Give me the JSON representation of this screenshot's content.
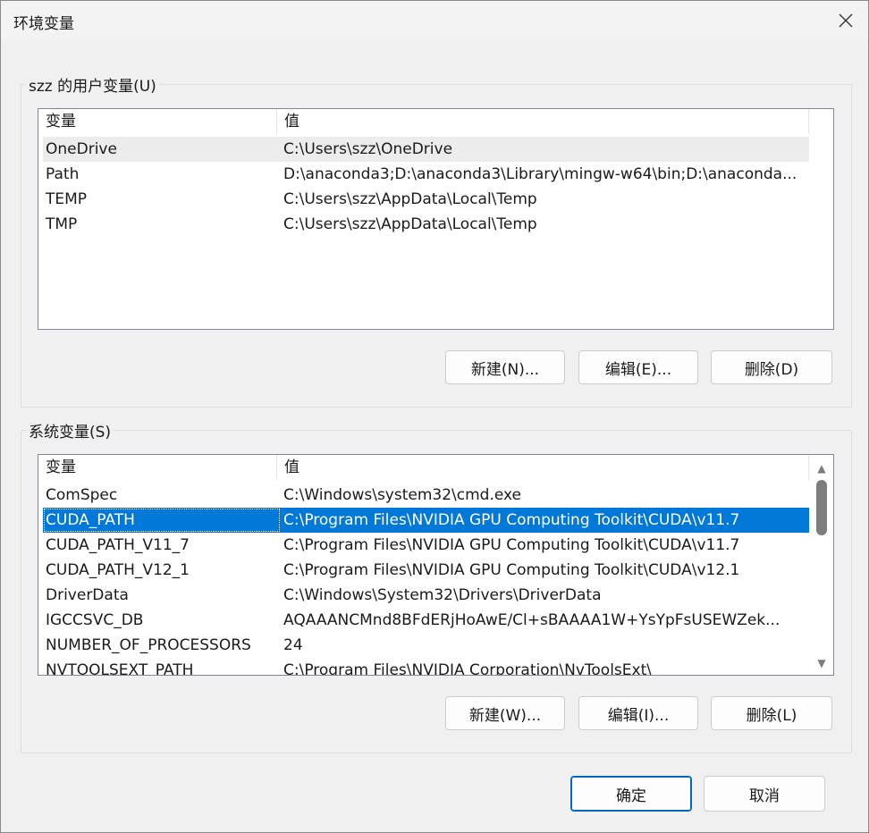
{
  "window": {
    "title": "环境变量"
  },
  "user_vars": {
    "legend": "szz 的用户变量(U)",
    "headers": [
      "变量",
      "值"
    ],
    "rows": [
      {
        "name": "OneDrive",
        "value": "C:\\Users\\szz\\OneDrive"
      },
      {
        "name": "Path",
        "value": "D:\\anaconda3;D:\\anaconda3\\Library\\mingw-w64\\bin;D:\\anaconda..."
      },
      {
        "name": "TEMP",
        "value": "C:\\Users\\szz\\AppData\\Local\\Temp"
      },
      {
        "name": "TMP",
        "value": "C:\\Users\\szz\\AppData\\Local\\Temp"
      }
    ],
    "buttons": {
      "new": "新建(N)...",
      "edit": "编辑(E)...",
      "delete": "删除(D)"
    }
  },
  "system_vars": {
    "legend": "系统变量(S)",
    "headers": [
      "变量",
      "值"
    ],
    "rows": [
      {
        "name": "ComSpec",
        "value": "C:\\Windows\\system32\\cmd.exe"
      },
      {
        "name": "CUDA_PATH",
        "value": "C:\\Program Files\\NVIDIA GPU Computing Toolkit\\CUDA\\v11.7"
      },
      {
        "name": "CUDA_PATH_V11_7",
        "value": "C:\\Program Files\\NVIDIA GPU Computing Toolkit\\CUDA\\v11.7"
      },
      {
        "name": "CUDA_PATH_V12_1",
        "value": "C:\\Program Files\\NVIDIA GPU Computing Toolkit\\CUDA\\v12.1"
      },
      {
        "name": "DriverData",
        "value": "C:\\Windows\\System32\\Drivers\\DriverData"
      },
      {
        "name": "IGCCSVC_DB",
        "value": "AQAAANCMnd8BFdERjHoAwE/Cl+sBAAAA1W+YsYpFsUSEWZek..."
      },
      {
        "name": "NUMBER_OF_PROCESSORS",
        "value": "24"
      },
      {
        "name": "NVTOOLSEXT_PATH",
        "value": "C:\\Program Files\\NVIDIA Corporation\\NvToolsExt\\"
      }
    ],
    "selected_index": 1,
    "buttons": {
      "new": "新建(W)...",
      "edit": "编辑(I)...",
      "delete": "删除(L)"
    }
  },
  "footer": {
    "ok": "确定",
    "cancel": "取消"
  },
  "colors": {
    "selection": "#0078d7",
    "primary_border": "#0067c0"
  }
}
